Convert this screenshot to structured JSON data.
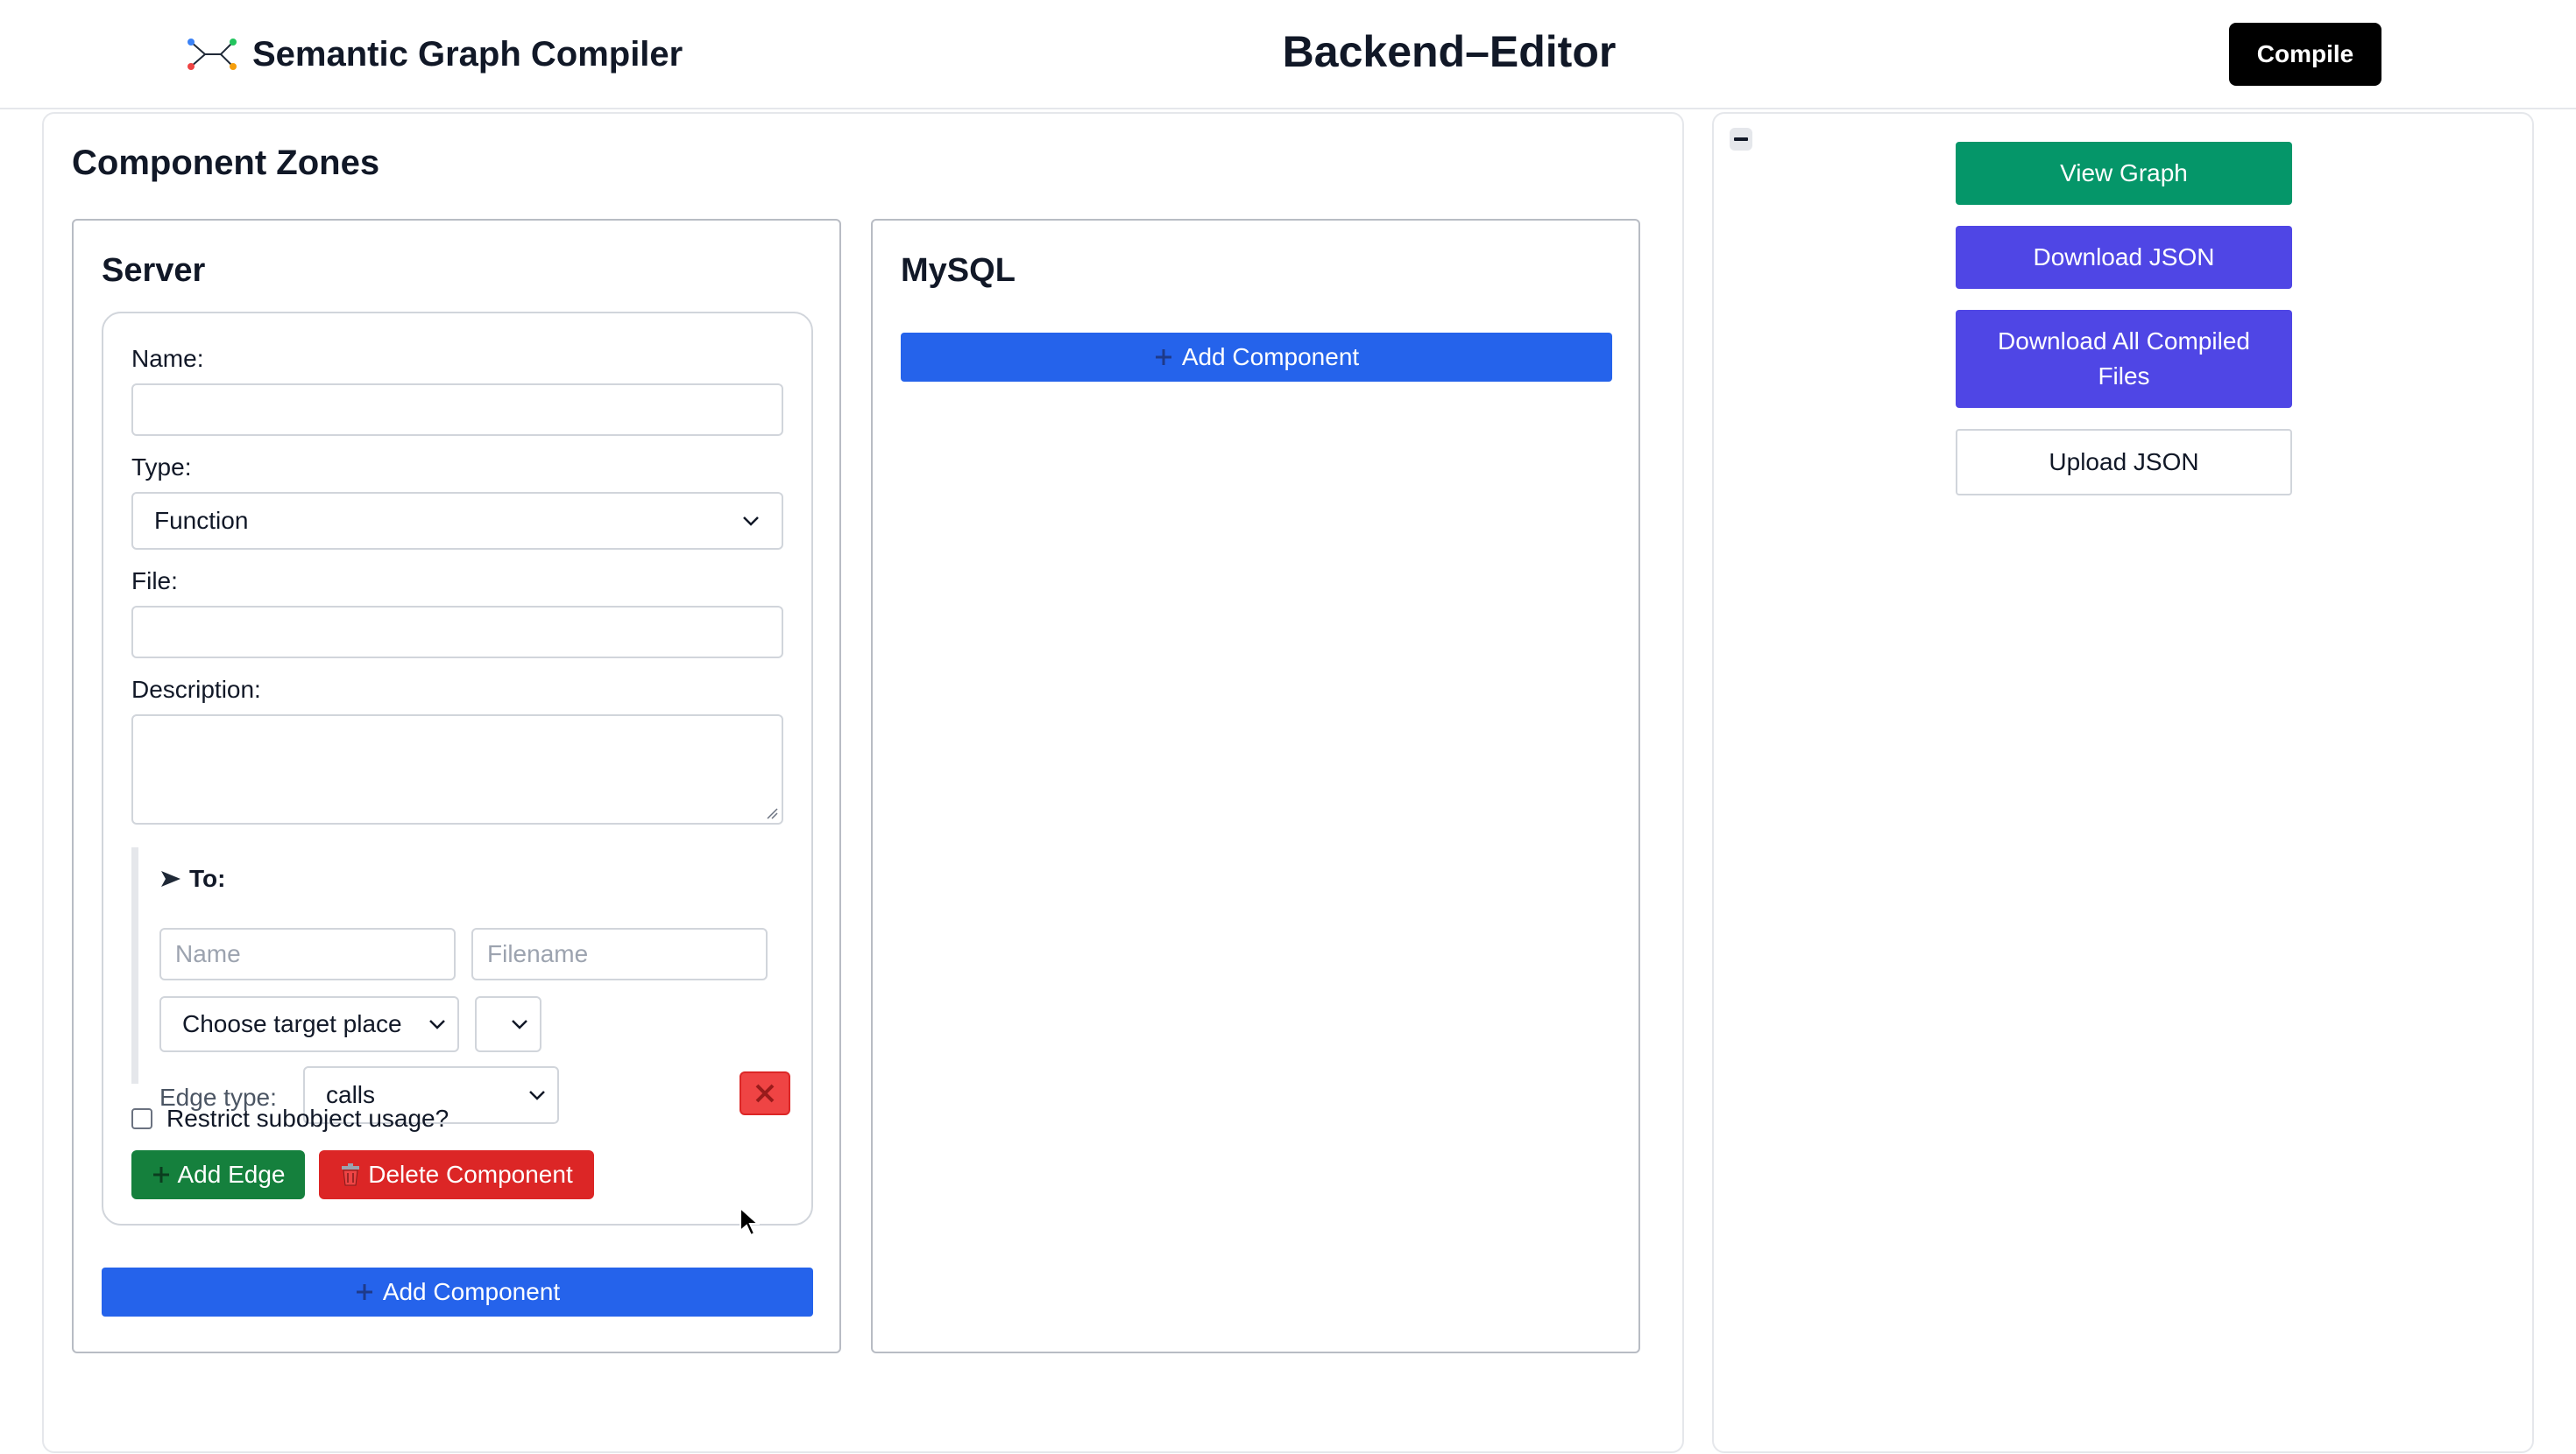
{
  "header": {
    "brand_title": "Semantic Graph Compiler",
    "page_title": "Backend–Editor",
    "compile_label": "Compile"
  },
  "main": {
    "zones_title": "Component Zones",
    "zones": [
      {
        "title": "Server",
        "component": {
          "name_label": "Name:",
          "name_value": "",
          "type_label": "Type:",
          "type_value": "Function",
          "file_label": "File:",
          "file_value": "",
          "description_label": "Description:",
          "description_value": "",
          "edge": {
            "to_label": "To:",
            "name_placeholder": "Name",
            "filename_placeholder": "Filename",
            "target_place_value": "Choose target place",
            "secondary_select_value": "",
            "edge_type_label": "Edge type:",
            "edge_type_value": "calls"
          },
          "restrict_label": "Restrict subobject usage?",
          "restrict_checked": false,
          "add_edge_label": "Add Edge",
          "delete_label": "Delete Component"
        },
        "add_component_label": "Add Component"
      },
      {
        "title": "MySQL",
        "add_component_label": "Add Component"
      }
    ]
  },
  "sidebar": {
    "view_graph_label": "View Graph",
    "download_json_label": "Download JSON",
    "download_all_label": "Download All Compiled Files",
    "upload_json_label": "Upload JSON"
  },
  "colors": {
    "primary_blue": "#2563eb",
    "success_green": "#15803d",
    "danger_red": "#dc2626",
    "indigo": "#4f46e5",
    "emerald": "#059669"
  },
  "icons": {
    "brand": "graph-nodes-icon",
    "arrow": "arrow-right-icon",
    "plus": "plus-icon",
    "trash": "trash-icon",
    "close": "close-icon",
    "collapse": "minus-icon",
    "chevron": "chevron-down-icon"
  }
}
